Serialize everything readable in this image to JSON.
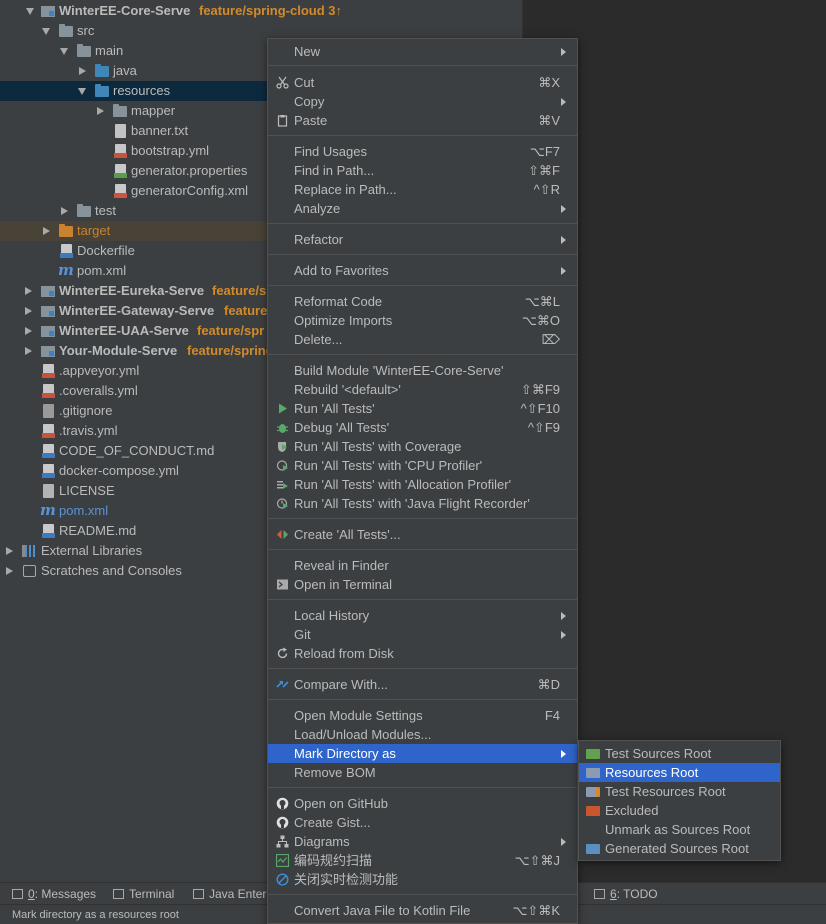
{
  "tree": {
    "rows": [
      {
        "label": "WinterEE-Core-Serve",
        "branch": "feature/spring-cloud 3↑"
      },
      {
        "label": "src"
      },
      {
        "label": "main"
      },
      {
        "label": "java"
      },
      {
        "label": "resources"
      },
      {
        "label": "mapper"
      },
      {
        "label": "banner.txt"
      },
      {
        "label": "bootstrap.yml"
      },
      {
        "label": "generator.properties"
      },
      {
        "label": "generatorConfig.xml"
      },
      {
        "label": "test"
      },
      {
        "label": "target"
      },
      {
        "label": "Dockerfile"
      },
      {
        "label": "pom.xml"
      },
      {
        "label": "WinterEE-Eureka-Serve",
        "branch": "feature/s"
      },
      {
        "label": "WinterEE-Gateway-Serve",
        "branch": "feature"
      },
      {
        "label": "WinterEE-UAA-Serve",
        "branch": "feature/spr"
      },
      {
        "label": "Your-Module-Serve",
        "branch": "feature/spring"
      },
      {
        "label": ".appveyor.yml"
      },
      {
        "label": ".coveralls.yml"
      },
      {
        "label": ".gitignore"
      },
      {
        "label": ".travis.yml"
      },
      {
        "label": "CODE_OF_CONDUCT.md"
      },
      {
        "label": "docker-compose.yml"
      },
      {
        "label": "LICENSE"
      },
      {
        "label": "pom.xml"
      },
      {
        "label": "README.md"
      },
      {
        "label": "External Libraries"
      },
      {
        "label": "Scratches and Consoles"
      }
    ]
  },
  "menu": {
    "items": [
      {
        "label": "New",
        "shortcut": ""
      },
      {
        "label": "Cut",
        "shortcut": "⌘X"
      },
      {
        "label": "Copy",
        "shortcut": ""
      },
      {
        "label": "Paste",
        "shortcut": "⌘V"
      },
      {
        "label": "Find Usages",
        "shortcut": "⌥F7"
      },
      {
        "label": "Find in Path...",
        "shortcut": "⇧⌘F"
      },
      {
        "label": "Replace in Path...",
        "shortcut": "^⇧R"
      },
      {
        "label": "Analyze",
        "shortcut": ""
      },
      {
        "label": "Refactor",
        "shortcut": ""
      },
      {
        "label": "Add to Favorites",
        "shortcut": ""
      },
      {
        "label": "Reformat Code",
        "shortcut": "⌥⌘L"
      },
      {
        "label": "Optimize Imports",
        "shortcut": "⌥⌘O"
      },
      {
        "label": "Delete...",
        "shortcut": "⌦"
      },
      {
        "label": "Build Module 'WinterEE-Core-Serve'",
        "shortcut": ""
      },
      {
        "label": "Rebuild '<default>'",
        "shortcut": "⇧⌘F9"
      },
      {
        "label": "Run 'All Tests'",
        "shortcut": "^⇧F10"
      },
      {
        "label": "Debug 'All Tests'",
        "shortcut": "^⇧F9"
      },
      {
        "label": "Run 'All Tests' with Coverage",
        "shortcut": ""
      },
      {
        "label": "Run 'All Tests' with 'CPU Profiler'",
        "shortcut": ""
      },
      {
        "label": "Run 'All Tests' with 'Allocation Profiler'",
        "shortcut": ""
      },
      {
        "label": "Run 'All Tests' with 'Java Flight Recorder'",
        "shortcut": ""
      },
      {
        "label": "Create 'All Tests'...",
        "shortcut": ""
      },
      {
        "label": "Reveal in Finder",
        "shortcut": ""
      },
      {
        "label": "Open in Terminal",
        "shortcut": ""
      },
      {
        "label": "Local History",
        "shortcut": ""
      },
      {
        "label": "Git",
        "shortcut": ""
      },
      {
        "label": "Reload from Disk",
        "shortcut": ""
      },
      {
        "label": "Compare With...",
        "shortcut": "⌘D"
      },
      {
        "label": "Open Module Settings",
        "shortcut": "F4"
      },
      {
        "label": "Load/Unload Modules...",
        "shortcut": ""
      },
      {
        "label": "Mark Directory as",
        "shortcut": ""
      },
      {
        "label": "Remove BOM",
        "shortcut": ""
      },
      {
        "label": "Open on GitHub",
        "shortcut": ""
      },
      {
        "label": "Create Gist...",
        "shortcut": ""
      },
      {
        "label": "Diagrams",
        "shortcut": ""
      },
      {
        "label": "编码规约扫描",
        "shortcut": "⌥⇧⌘J"
      },
      {
        "label": "关闭实时检测功能",
        "shortcut": ""
      },
      {
        "label": "Convert Java File to Kotlin File",
        "shortcut": "⌥⇧⌘K"
      }
    ]
  },
  "submenu": {
    "items": [
      {
        "label": "Test Sources Root"
      },
      {
        "label": "Resources Root"
      },
      {
        "label": "Test Resources Root"
      },
      {
        "label": "Excluded"
      },
      {
        "label": "Unmark as Sources Root"
      },
      {
        "label": "Generated Sources Root"
      }
    ]
  },
  "toolwindows": {
    "messages_num": "0",
    "messages_label": ": Messages",
    "terminal": "Terminal",
    "java_enterprise": "Java Enterp",
    "todo_num": "6",
    "todo_label": ": TODO"
  },
  "status": {
    "text": "Mark directory as a resources root"
  },
  "colors": {
    "accent": "#2f65ca",
    "branch": "#d38a2a",
    "selected_row": "#0d293e"
  }
}
